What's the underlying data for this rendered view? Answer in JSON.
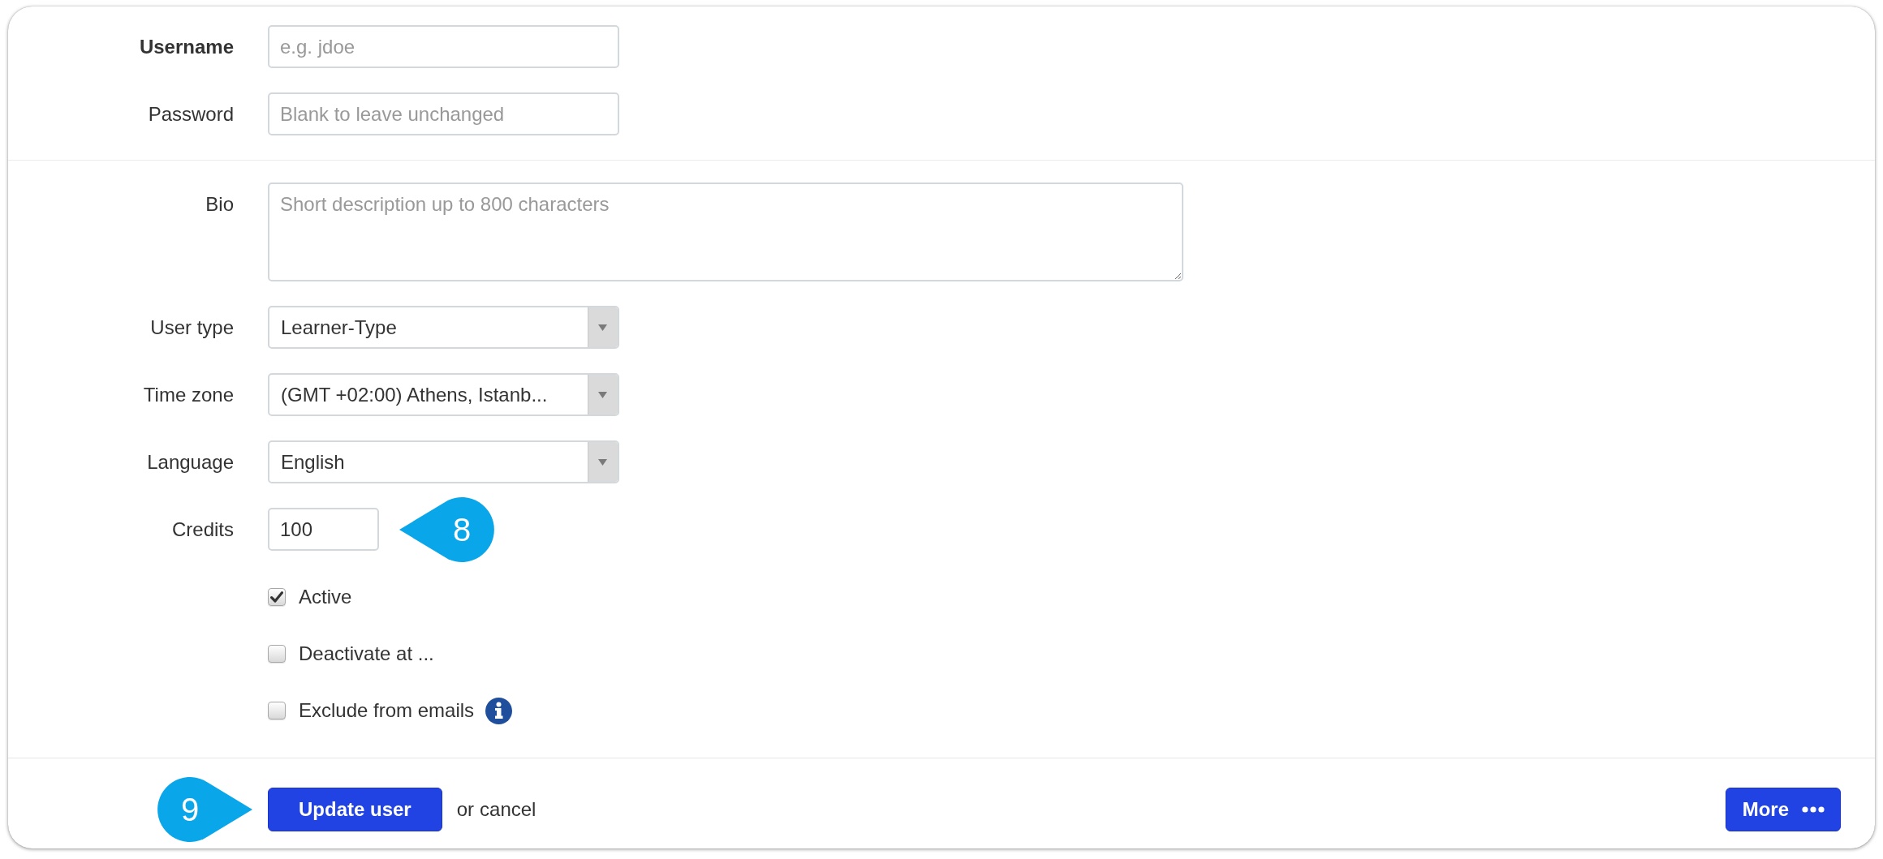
{
  "account_fields": [
    {
      "label": "Username",
      "emphasized": true,
      "placeholder": "e.g. jdoe"
    },
    {
      "label": "Password",
      "emphasized": false,
      "placeholder": "Blank to leave unchanged"
    }
  ],
  "profile_fields": [
    {
      "kind": "textarea",
      "label": "Bio",
      "placeholder": "Short description up to 800 characters"
    },
    {
      "kind": "select",
      "label": "User type",
      "value": "Learner-Type"
    },
    {
      "kind": "select",
      "label": "Time zone",
      "value": "(GMT +02:00) Athens, Istanb..."
    },
    {
      "kind": "select",
      "label": "Language",
      "value": "English"
    },
    {
      "kind": "number",
      "label": "Credits",
      "value": "100",
      "callout": "8"
    }
  ],
  "checkboxes": [
    {
      "label": "Active",
      "checked": true,
      "info": false
    },
    {
      "label": "Deactivate at ...",
      "checked": false,
      "info": false
    },
    {
      "label": "Exclude from emails",
      "checked": false,
      "info": true
    }
  ],
  "footer": {
    "callout": "9",
    "submit_button": "Update user",
    "cancel_prefix": "or",
    "cancel_link": "cancel",
    "more_button": "More"
  }
}
